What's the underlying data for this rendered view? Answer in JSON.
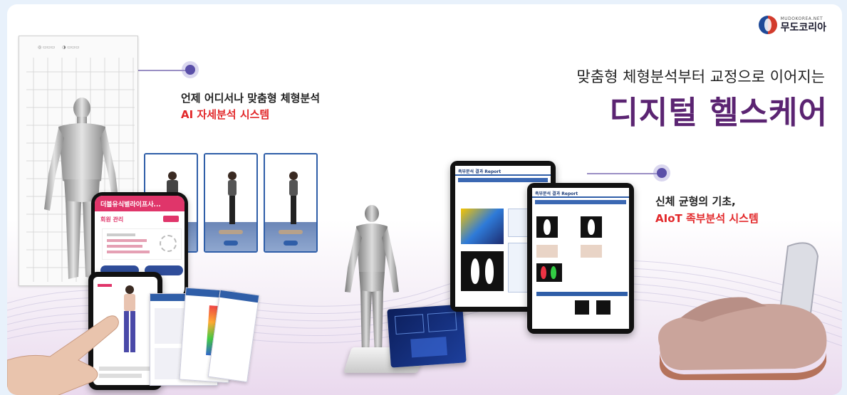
{
  "brand": {
    "small_text": "MUDOKOREA.NET",
    "name": "무도코리아"
  },
  "headline": {
    "subtitle": "맞춤형 체형분석부터 교정으로 이어지는",
    "title": "디지털 헬스케어"
  },
  "callouts": {
    "posture": {
      "title": "언제 어디서나 맞춤형 체형분석",
      "accent": "AI 자세분석 시스템"
    },
    "foot": {
      "title": "신체 균형의 기초,",
      "accent": "AIoT 족부분석 시스템"
    }
  },
  "phone": {
    "header": "더블유식별라이프사...",
    "section": "회원 관리"
  },
  "tablets": {
    "report_title_back": "족부분석 결과 Report",
    "report_title_front": "족부분석 결과 Report"
  },
  "colors": {
    "accent_red": "#e2282a",
    "headline_purple": "#5b2472",
    "ui_blue": "#2f5ea8"
  }
}
